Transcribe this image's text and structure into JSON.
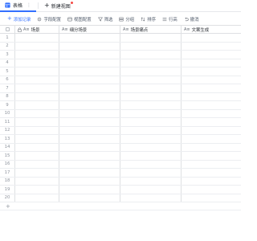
{
  "tabs": {
    "active_label": "表格",
    "more_glyph": "⋮",
    "new_view_label": "新建视图",
    "new_view_plus": "+"
  },
  "toolbar": {
    "add_record": "添加记录",
    "add_plus": "+",
    "field_config": "字段配置",
    "view_config": "视图配置",
    "filter": "筛选",
    "group": "分组",
    "sort": "排序",
    "row_height": "行高",
    "undo": "撤消"
  },
  "table": {
    "columns": [
      {
        "type_glyph": "A≡",
        "label": "场景",
        "locked": true
      },
      {
        "type_glyph": "A≡",
        "label": "细分场景"
      },
      {
        "type_glyph": "A≡",
        "label": "场景痛点"
      },
      {
        "type_glyph": "A≡",
        "label": "文案生成"
      }
    ],
    "row_numbers": [
      "1",
      "2",
      "3",
      "4",
      "5",
      "6",
      "7",
      "8",
      "9",
      "10",
      "11",
      "12",
      "13",
      "14",
      "15",
      "16",
      "17",
      "18",
      "19",
      "20"
    ],
    "add_row_glyph": "+"
  },
  "colors": {
    "accent": "#3370ff",
    "grid_line": "#dee0e3",
    "muted_text": "#8f959e",
    "badge_red": "#f54a45"
  },
  "icons": [
    "table-icon",
    "plus-icon",
    "field-config-icon",
    "view-config-icon",
    "filter-icon",
    "group-icon",
    "sort-icon",
    "row-height-icon",
    "undo-icon",
    "lock-icon",
    "text-field-icon"
  ]
}
